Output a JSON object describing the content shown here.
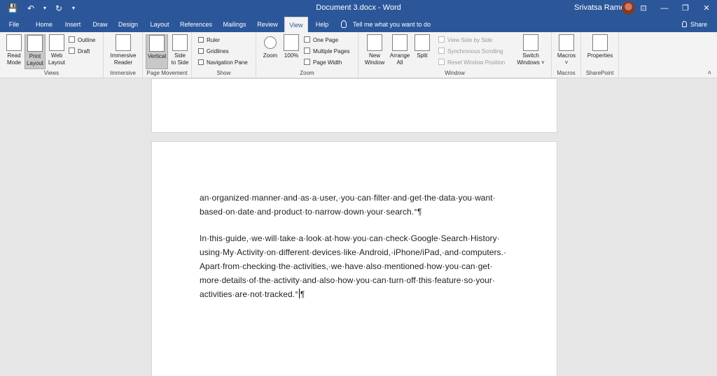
{
  "titlebar": {
    "doc_title": "Document 3.docx  -  Word",
    "user_name": "Srivatsa Ramesh",
    "qat": {
      "save": "💾",
      "undo": "↶",
      "undo_drop": "▾",
      "redo": "↻",
      "custom": "▾"
    },
    "window_buttons": {
      "ribbon_options": "⊡",
      "minimize": "—",
      "restore": "❐",
      "close": "✕"
    }
  },
  "tabs": [
    "File",
    "Home",
    "Insert",
    "Draw",
    "Design",
    "Layout",
    "References",
    "Mailings",
    "Review",
    "View",
    "Help"
  ],
  "active_tab": "View",
  "tell_me": "Tell me what you want to do",
  "share": "Share",
  "ribbon": {
    "views": {
      "label": "Views",
      "read_mode": [
        "Read",
        "Mode"
      ],
      "print_layout": [
        "Print",
        "Layout"
      ],
      "web_layout": [
        "Web",
        "Layout"
      ],
      "outline": "Outline",
      "draft": "Draft"
    },
    "immersive": {
      "label": "Immersive",
      "reader": [
        "Immersive",
        "Reader"
      ]
    },
    "page_movement": {
      "label": "Page Movement",
      "vertical": "Vertical",
      "side": [
        "Side",
        "to Side"
      ]
    },
    "show": {
      "label": "Show",
      "ruler": "Ruler",
      "gridlines": "Gridlines",
      "navigation_pane": "Navigation Pane"
    },
    "zoom": {
      "label": "Zoom",
      "zoom": "Zoom",
      "hundred": "100%",
      "one_page": "One Page",
      "multiple_pages": "Multiple Pages",
      "page_width": "Page Width"
    },
    "window": {
      "label": "Window",
      "new_window": [
        "New",
        "Window"
      ],
      "arrange_all": [
        "Arrange",
        "All"
      ],
      "split": "Split",
      "view_side_by_side": "View Side by Side",
      "sync_scrolling": "Synchronous Scrolling",
      "reset_position": "Reset Window Position",
      "switch_windows": [
        "Switch",
        "Windows ˅"
      ]
    },
    "macros": {
      "label": "Macros",
      "macros": [
        "Macros",
        "˅"
      ]
    },
    "sharepoint": {
      "label": "SharePoint",
      "properties": "Properties"
    },
    "collapse": "˄"
  },
  "document": {
    "para1": [
      "an·organized·manner·and·as·a·user,·you·can·filter·and·get·the·data·you·want·",
      "based·on·date·and·product·to·narrow·down·your·search.°¶"
    ],
    "para2": [
      "In·this·guide,·we·will·take·a·look·at·how·you·can·check·Google·Search·History·",
      "using·My·Activity·on·different·devices·like·Android,·iPhone/iPad,·and·computers.·",
      "Apart·from·checking·the·activities,·we·have·also·mentioned·how·you·can·get·",
      "more·details·of·the·activity·and·also·how·you·can·turn·off·this·feature·so·your·",
      "activities·are·not·tracked.°",
      "¶"
    ]
  }
}
